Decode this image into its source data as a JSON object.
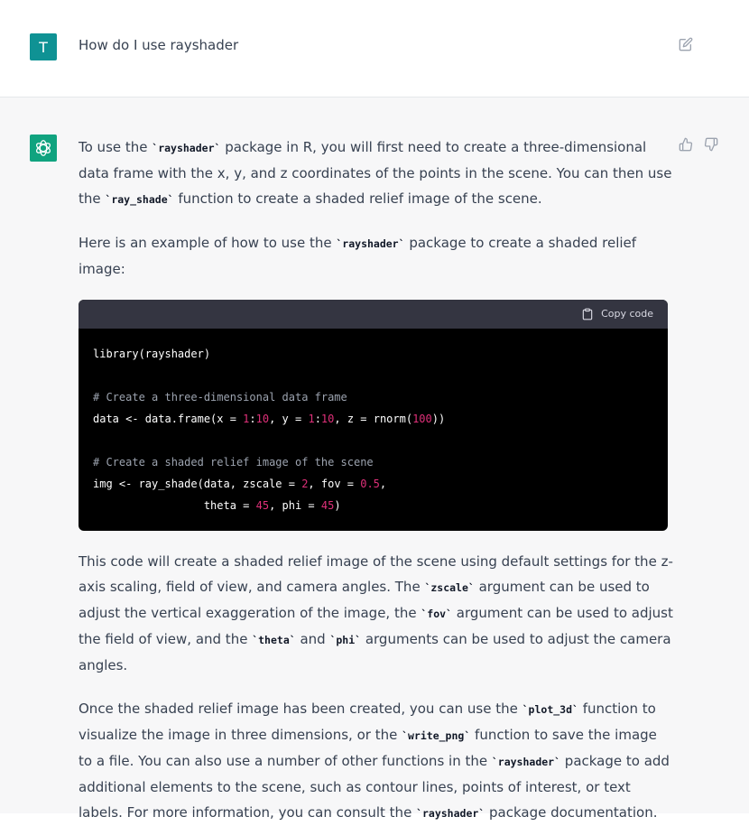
{
  "user": {
    "avatar_letter": "T",
    "message": "How do I use rayshader"
  },
  "assistant": {
    "para1": [
      "To use the ",
      "`rayshader`",
      " package in R, you will first need to create a three-dimensional data frame with the x, y, and z coordinates of the points in the scene. You can then use the ",
      "`ray_shade`",
      " function to create a shaded relief image of the scene."
    ],
    "para2": [
      "Here is an example of how to use the ",
      "`rayshader`",
      " package to create a shaded relief image:"
    ],
    "code": {
      "copy_label": "Copy code",
      "lines": [
        [
          {
            "t": "library(rayshader)",
            "c": ""
          }
        ],
        [],
        [
          {
            "t": "# Create a three-dimensional data frame",
            "c": "comment"
          }
        ],
        [
          {
            "t": "data <- data.frame(x = ",
            "c": ""
          },
          {
            "t": "1",
            "c": "num"
          },
          {
            "t": ":",
            "c": ""
          },
          {
            "t": "10",
            "c": "num"
          },
          {
            "t": ", y = ",
            "c": ""
          },
          {
            "t": "1",
            "c": "num"
          },
          {
            "t": ":",
            "c": ""
          },
          {
            "t": "10",
            "c": "num"
          },
          {
            "t": ", z = rnorm(",
            "c": ""
          },
          {
            "t": "100",
            "c": "num"
          },
          {
            "t": "))",
            "c": ""
          }
        ],
        [],
        [
          {
            "t": "# Create a shaded relief image of the scene",
            "c": "comment"
          }
        ],
        [
          {
            "t": "img <- ray_shade(data, zscale = ",
            "c": ""
          },
          {
            "t": "2",
            "c": "num"
          },
          {
            "t": ", fov = ",
            "c": ""
          },
          {
            "t": "0.5",
            "c": "num"
          },
          {
            "t": ",",
            "c": ""
          }
        ],
        [
          {
            "t": "                 theta = ",
            "c": ""
          },
          {
            "t": "45",
            "c": "num"
          },
          {
            "t": ", phi = ",
            "c": ""
          },
          {
            "t": "45",
            "c": "num"
          },
          {
            "t": ")",
            "c": ""
          }
        ]
      ]
    },
    "para3": [
      "This code will create a shaded relief image of the scene using default settings for the z-axis scaling, field of view, and camera angles. The ",
      "`zscale`",
      " argument can be used to adjust the vertical exaggeration of the image, the ",
      "`fov`",
      " argument can be used to adjust the field of view, and the ",
      "`theta`",
      " and ",
      "`phi`",
      " arguments can be used to adjust the camera angles."
    ],
    "para4": [
      "Once the shaded relief image has been created, you can use the ",
      "`plot_3d`",
      " function to visualize the image in three dimensions, or the ",
      "`write_png`",
      " function to save the image to a file. You can also use a number of other functions in the ",
      "`rayshader`",
      " package to add additional elements to the scene, such as contour lines, points of interest, or text labels. For more information, you can consult the ",
      "`rayshader`",
      " package documentation."
    ]
  },
  "colors": {
    "user_avatar": "#0f9294",
    "bot_avatar": "#10a37f",
    "number_token": "#df3079",
    "comment_token": "#9ca3af"
  },
  "icons": {
    "edit": "edit-icon",
    "thumbs_up": "thumbs-up-icon",
    "thumbs_down": "thumbs-down-icon",
    "clipboard": "clipboard-icon",
    "bot": "openai-logo-icon"
  }
}
